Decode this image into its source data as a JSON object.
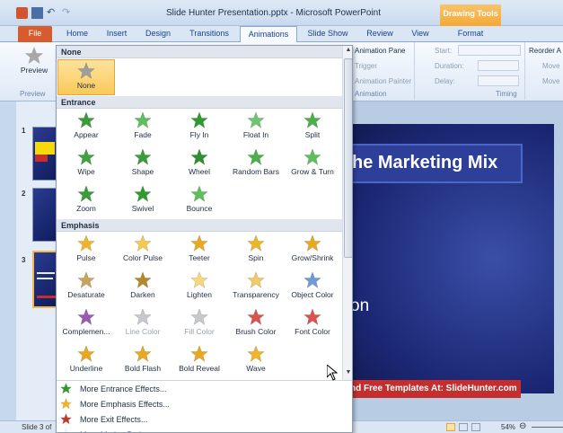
{
  "window": {
    "title": "Slide Hunter  Presentation.pptx  -  Microsoft PowerPoint",
    "contextual_tab_group": "Drawing Tools"
  },
  "tabs": [
    "File",
    "Home",
    "Insert",
    "Design",
    "Transitions",
    "Animations",
    "Slide Show",
    "Review",
    "View",
    "Format"
  ],
  "active_tab": "Animations",
  "ribbon": {
    "preview_label": "Preview",
    "preview_group": "Preview",
    "animation_pane": "Animation Pane",
    "trigger": "Trigger",
    "animation_painter": "Animation Painter",
    "advanced_group": "Animation",
    "start_label": "Start:",
    "duration_label": "Duration:",
    "delay_label": "Delay:",
    "timing_group": "Timing",
    "reorder_label": "Reorder A",
    "move_earlier": "Move",
    "move_later": "Move"
  },
  "slides_pane": {
    "numbers": [
      "1",
      "2",
      "3"
    ],
    "selected": "3"
  },
  "slide": {
    "title": "he Marketing Mix",
    "subtitle": "on",
    "banner": "nd Free Templates At: SlideHunter.com"
  },
  "status_bar": {
    "slide_info": "Slide 3 of",
    "zoom": "54%"
  },
  "gallery": {
    "sections": {
      "none": "None",
      "entrance": "Entrance",
      "emphasis": "Emphasis"
    },
    "none_effects": [
      {
        "label": "None",
        "color": "#9e9e9e",
        "selected": true
      }
    ],
    "entrance_effects": [
      {
        "label": "Appear",
        "color": "#3a9b3a"
      },
      {
        "label": "Fade",
        "color": "#5cbf5c"
      },
      {
        "label": "Fly In",
        "color": "#2e9b2e"
      },
      {
        "label": "Float In",
        "color": "#6fc56f"
      },
      {
        "label": "Split",
        "color": "#4caf4c"
      },
      {
        "label": "Wipe",
        "color": "#3fa23f"
      },
      {
        "label": "Shape",
        "color": "#3a9b3a"
      },
      {
        "label": "Wheel",
        "color": "#2f8f2f"
      },
      {
        "label": "Random Bars",
        "color": "#4caf4c"
      },
      {
        "label": "Grow & Turn",
        "color": "#5cbf5c"
      },
      {
        "label": "Zoom",
        "color": "#3a9b3a"
      },
      {
        "label": "Swivel",
        "color": "#2e9b2e"
      },
      {
        "label": "Bounce",
        "color": "#5cbf5c"
      }
    ],
    "emphasis_effects": [
      {
        "label": "Pulse",
        "color": "#f0b429"
      },
      {
        "label": "Color Pulse",
        "color": "#f6c94e"
      },
      {
        "label": "Teeter",
        "color": "#e9a81e"
      },
      {
        "label": "Spin",
        "color": "#f0b429"
      },
      {
        "label": "Grow/Shrink",
        "color": "#e9a81e"
      },
      {
        "label": "Desaturate",
        "color": "#c9a45a"
      },
      {
        "label": "Darken",
        "color": "#b8862a"
      },
      {
        "label": "Lighten",
        "color": "#f8d77a"
      },
      {
        "label": "Transparency",
        "color": "#f3c869"
      },
      {
        "label": "Object Color",
        "color": "#6f9ad8"
      },
      {
        "label": "Complemen...",
        "color": "#9b59b6"
      },
      {
        "label": "Line Color",
        "color": "#c5c9ce",
        "disabled": true
      },
      {
        "label": "Fill Color",
        "color": "#c5c9ce",
        "disabled": true
      },
      {
        "label": "Brush Color",
        "color": "#d9534f"
      },
      {
        "label": "Font Color",
        "color": "#d9534f"
      },
      {
        "label": "Underline",
        "color": "#e9a81e"
      },
      {
        "label": "Bold Flash",
        "color": "#e9a81e"
      },
      {
        "label": "Bold Reveal",
        "color": "#e9a81e"
      },
      {
        "label": "Wave",
        "color": "#f0b429"
      }
    ],
    "more_links": [
      {
        "label": "More Entrance Effects...",
        "color": "#2e9b2e"
      },
      {
        "label": "More Emphasis Effects...",
        "color": "#f0b429"
      },
      {
        "label": "More Exit Effects...",
        "color": "#c0392b"
      },
      {
        "label": "More Motion Paths...",
        "color": "#ffffff"
      }
    ]
  }
}
